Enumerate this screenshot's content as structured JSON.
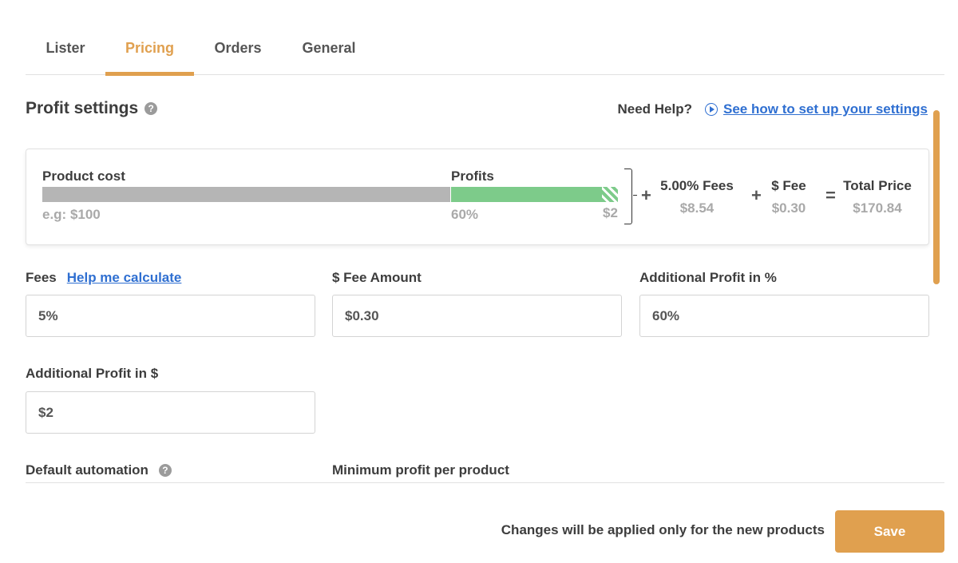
{
  "tabs": [
    {
      "label": "Lister",
      "active": false
    },
    {
      "label": "Pricing",
      "active": true
    },
    {
      "label": "Orders",
      "active": false
    },
    {
      "label": "General",
      "active": false
    }
  ],
  "section": {
    "title": "Profit settings",
    "help_icon": "question-icon",
    "need_help": "Need Help?",
    "help_link": "See how to set up your settings"
  },
  "breakdown": {
    "product_cost_label": "Product cost",
    "product_cost_example": "e.g: $100",
    "profits_label": "Profits",
    "profits_percent": "60%",
    "profits_dollar": "$2",
    "plus": "+",
    "equals": "=",
    "fees_label": "5.00% Fees",
    "fees_value": "$8.54",
    "fee_label": "$ Fee",
    "fee_value": "$0.30",
    "total_label": "Total Price",
    "total_value": "$170.84"
  },
  "fields": {
    "fees": {
      "label": "Fees",
      "link": "Help me calculate",
      "value": "5%"
    },
    "fee_amount": {
      "label": "$ Fee Amount",
      "value": "$0.30"
    },
    "profit_percent": {
      "label": "Additional Profit in %",
      "value": "60%"
    },
    "profit_dollar": {
      "label": "Additional Profit in $",
      "value": "$2"
    }
  },
  "automation": {
    "default_label": "Default automation",
    "min_profit_label": "Minimum profit per product"
  },
  "footer": {
    "note": "Changes will be applied only for the new products",
    "save_label": "Save"
  },
  "colors": {
    "accent": "#e0a04f",
    "link": "#2f6fd1",
    "profit_bar": "#7dcb8a",
    "cost_bar": "#b5b5b5"
  }
}
